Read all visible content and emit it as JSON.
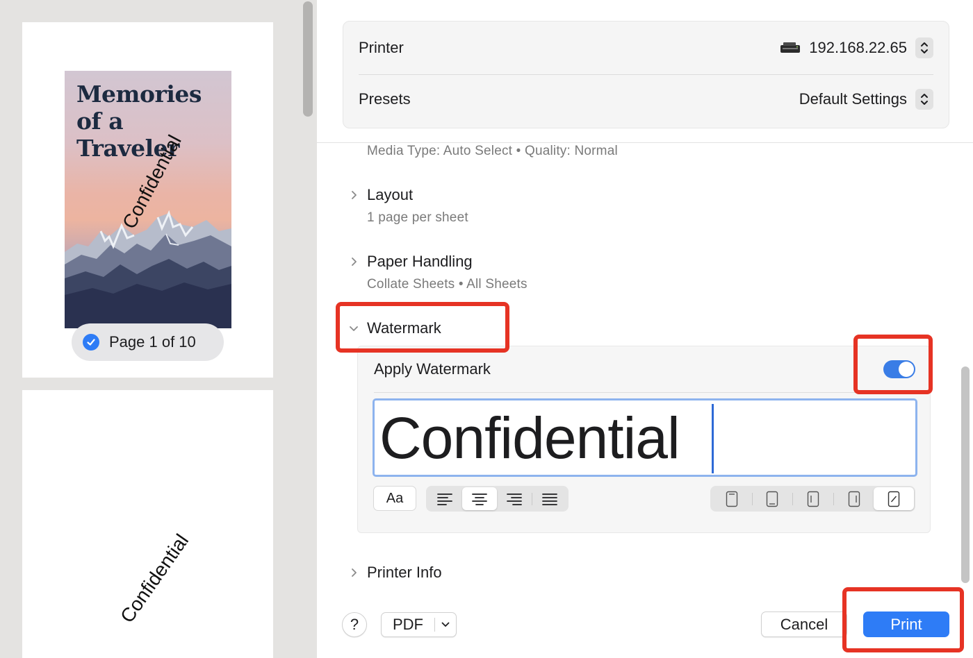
{
  "preview": {
    "cover_title_lines": [
      "Memories",
      "of a",
      "Traveler"
    ],
    "watermark_text": "Confidential",
    "page_indicator": "Page 1 of 10"
  },
  "printer": {
    "label": "Printer",
    "value": "192.168.22.65",
    "icon": "printer-icon"
  },
  "presets": {
    "label": "Presets",
    "value": "Default Settings"
  },
  "media_summary": "Media Type: Auto Select • Quality: Normal",
  "sections": {
    "layout": {
      "title": "Layout",
      "summary": "1 page per sheet",
      "expanded": false
    },
    "paper_handling": {
      "title": "Paper Handling",
      "summary": "Collate Sheets • All Sheets",
      "expanded": false
    },
    "watermark": {
      "title": "Watermark",
      "expanded": true
    },
    "printer_info": {
      "title": "Printer Info",
      "expanded": false
    }
  },
  "watermark": {
    "apply_label": "Apply Watermark",
    "apply_enabled": true,
    "text_value": "Confidential",
    "font_button": "Aa",
    "alignment_options": [
      "align-left-icon",
      "align-center-icon",
      "align-right-icon",
      "align-justify-icon"
    ],
    "alignment_selected": "align-center-icon",
    "position_options": [
      "position-top-icon",
      "position-bottom-icon",
      "position-left-icon",
      "position-right-icon",
      "position-diagonal-icon"
    ],
    "position_selected": "position-diagonal-icon"
  },
  "footer": {
    "help_label": "?",
    "pdf_label": "PDF",
    "cancel_label": "Cancel",
    "print_label": "Print"
  },
  "colors": {
    "accent": "#2e7cf6",
    "annotation": "#e63324",
    "secondary_text": "#7a7a7a"
  }
}
